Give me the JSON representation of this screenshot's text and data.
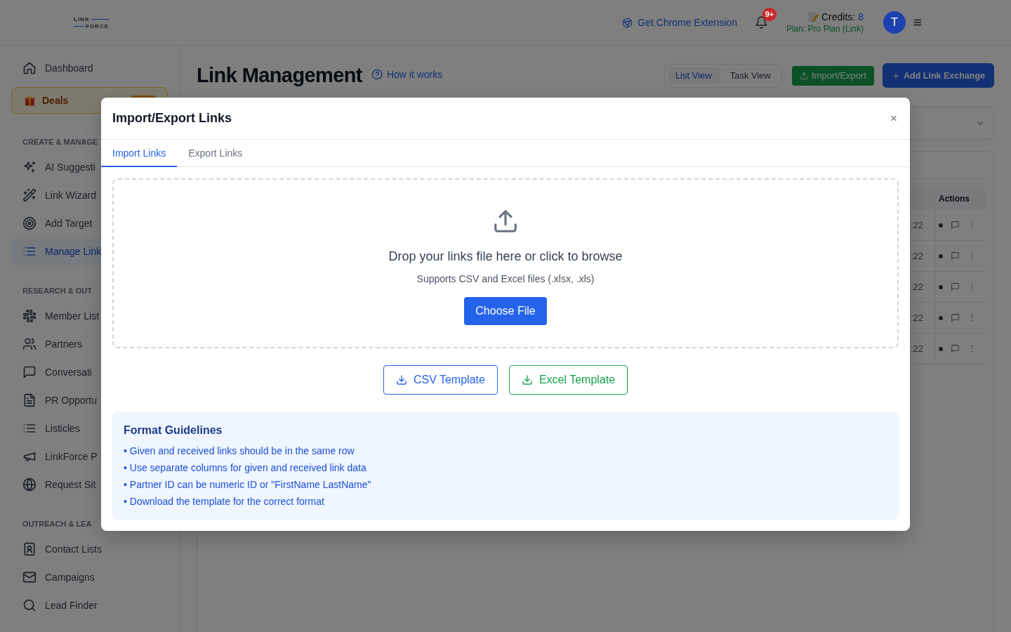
{
  "header": {
    "logo": {
      "top": "LINK",
      "bottom": "FORCE"
    },
    "extension_link": "Get Chrome Extension",
    "notification_count": "9+",
    "credits": {
      "label": "Credits:",
      "value": "8",
      "plan": "Plan: Pro Plan (Link)"
    },
    "avatar_initial": "T"
  },
  "sidebar": {
    "top_items": [
      {
        "kind": "link",
        "label": "Dashboard",
        "selected": false
      },
      {
        "kind": "promo",
        "label": "Deals",
        "selected": false
      }
    ],
    "sections": [
      {
        "heading": "CREATE & MANAGE",
        "items": [
          {
            "label": "AI Suggesti",
            "selected": false
          },
          {
            "label": "Link Wizard",
            "selected": false
          },
          {
            "label": "Add Target",
            "selected": false
          },
          {
            "label": "Manage Link",
            "selected": true
          }
        ]
      },
      {
        "heading": "RESEARCH & OUT",
        "items": [
          {
            "label": "Member List",
            "selected": false
          },
          {
            "label": "Partners",
            "selected": false
          },
          {
            "label": "Conversati",
            "selected": false
          },
          {
            "label": "PR Opportu",
            "selected": false
          },
          {
            "label": "Listicles",
            "selected": false
          },
          {
            "label": "LinkForce P",
            "selected": false
          },
          {
            "label": "Request Sit",
            "selected": false
          }
        ]
      },
      {
        "heading": "OUTREACH & LEA",
        "items": [
          {
            "label": "Contact Lists",
            "selected": false
          },
          {
            "label": "Campaigns",
            "selected": false
          },
          {
            "label": "Lead Finder",
            "selected": false
          }
        ]
      }
    ]
  },
  "main": {
    "title": "Link Management",
    "help_link": "How it works",
    "view_toggle": [
      {
        "label": "List View",
        "selected": true
      },
      {
        "label": "Task View",
        "selected": false
      }
    ],
    "buttons": [
      {
        "kind": "import",
        "label": "Import/Export"
      },
      {
        "kind": "add",
        "label": "Add Link Exchange"
      }
    ],
    "table": {
      "action_heading": "Actions",
      "rows": [
        {
          "column_1": ":22"
        },
        {
          "column_1": ":22"
        },
        {
          "column_1": ":22"
        },
        {
          "column_1": ":22"
        },
        {
          "column_1": ":22"
        }
      ]
    }
  },
  "modal": {
    "title": "Import/Export Links",
    "close_label": "×",
    "tabs": [
      {
        "label": "Import Links",
        "selected": true
      },
      {
        "label": "Export Links",
        "selected": false
      }
    ],
    "dropzone": {
      "title": "Drop your links file here or click to browse",
      "hint": "Supports CSV and Excel files (.xlsx, .xls)",
      "button": "Choose File"
    },
    "templates": [
      {
        "kind": "csv",
        "label": "CSV Template"
      },
      {
        "kind": "excel",
        "label": "Excel Template"
      }
    ],
    "guidelines": {
      "title": "Format Guidelines",
      "items": [
        "• Given and received links should be in the same row",
        "• Use separate columns for given and received link data",
        "• Partner ID can be numeric ID or \"FirstName LastName\"",
        "• Download the template for the correct format"
      ]
    }
  }
}
